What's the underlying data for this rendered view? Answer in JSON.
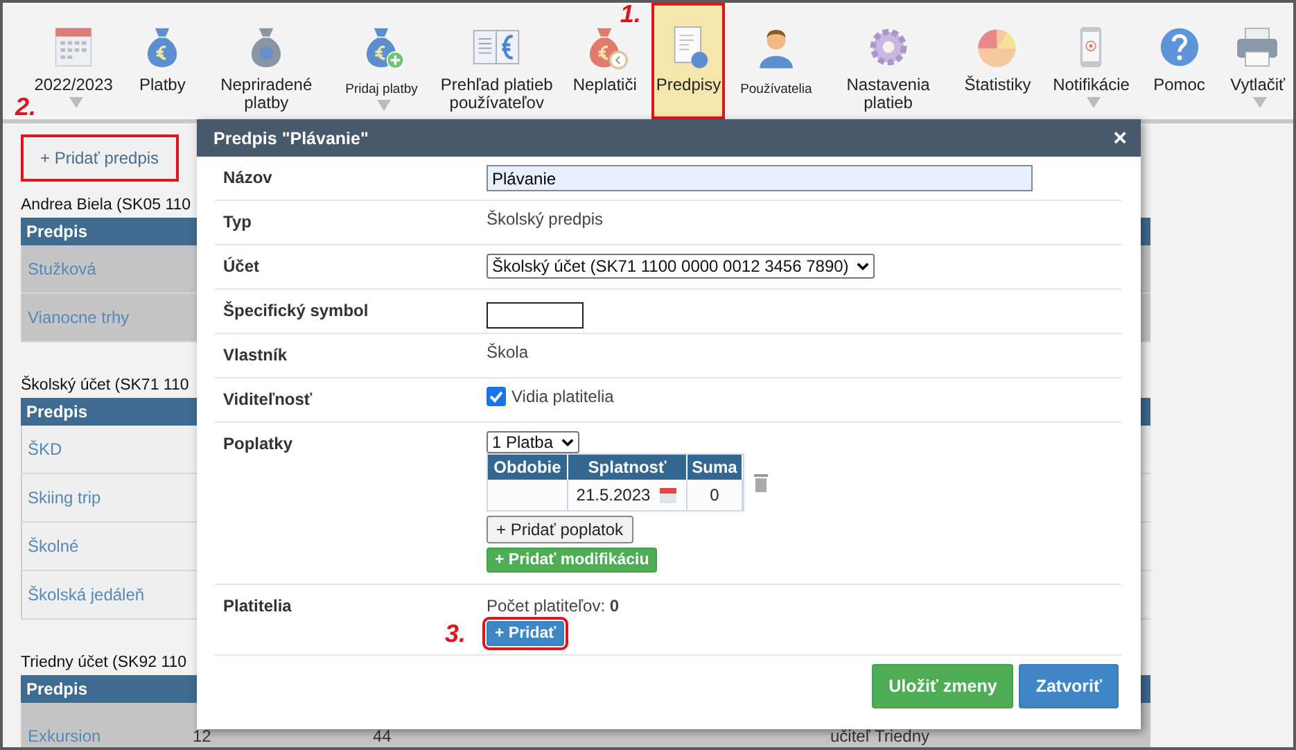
{
  "toolbar": [
    {
      "label": "2022/2023",
      "dropdown": true,
      "selected": false,
      "small": false
    },
    {
      "label": "Platby",
      "dropdown": false,
      "selected": false,
      "small": false
    },
    {
      "label": "Nepriradené platby",
      "dropdown": false,
      "selected": false,
      "small": false
    },
    {
      "label": "Pridaj platby",
      "dropdown": true,
      "selected": false,
      "small": true
    },
    {
      "label": "Prehľad platieb používateľov",
      "dropdown": false,
      "selected": false,
      "small": false
    },
    {
      "label": "Neplatiči",
      "dropdown": false,
      "selected": false,
      "small": false
    },
    {
      "label": "Predpisy",
      "dropdown": false,
      "selected": true,
      "small": false,
      "marker": "1."
    },
    {
      "label": "Používatelia",
      "dropdown": false,
      "selected": false,
      "small": true
    },
    {
      "label": "Nastavenia platieb",
      "dropdown": false,
      "selected": false,
      "small": false
    },
    {
      "label": "Štatistiky",
      "dropdown": false,
      "selected": false,
      "small": false
    },
    {
      "label": "Notifikácie",
      "dropdown": true,
      "selected": false,
      "small": false
    },
    {
      "label": "Pomoc",
      "dropdown": false,
      "selected": false,
      "small": false
    },
    {
      "label": "Vytlačiť",
      "dropdown": true,
      "selected": false,
      "small": false
    }
  ],
  "add_button": {
    "label": "+ Pridať predpis",
    "marker": "2."
  },
  "sections": [
    {
      "title": "Andrea Biela (SK05 110",
      "header": "Predpis",
      "rows": [
        {
          "name": "Stužková",
          "highlighted": true
        },
        {
          "name": "Vianocne trhy",
          "highlighted": true
        }
      ]
    },
    {
      "title": "Školský účet (SK71 110",
      "header": "Predpis",
      "rows": [
        {
          "name": "ŠKD",
          "highlighted": false
        },
        {
          "name": "Skiing trip",
          "highlighted": false
        },
        {
          "name": "Školné",
          "highlighted": false
        },
        {
          "name": "Školská jedáleň",
          "highlighted": false
        }
      ]
    },
    {
      "title": "Triedny účet (SK92 110",
      "header": "Predpis",
      "rows": [
        {
          "name": "Exkursion",
          "highlighted": true,
          "cells": [
            "12",
            "44",
            "učiteľ Triedny"
          ]
        }
      ]
    }
  ],
  "dialog": {
    "title": "Predpis \"Plávanie\"",
    "close": "×",
    "fields": [
      {
        "kind": "input",
        "label": "Názov",
        "value": "Plávanie"
      },
      {
        "kind": "text",
        "label": "Typ",
        "value": "Školský predpis"
      },
      {
        "kind": "select",
        "label": "Účet",
        "value": "Školský účet (SK71 1100 0000 0012 3456 7890)"
      },
      {
        "kind": "small-input",
        "label": "Špecifický symbol"
      },
      {
        "kind": "text",
        "label": "Vlastník",
        "value": "Škola"
      },
      {
        "kind": "checkbox",
        "label": "Viditeľnosť",
        "value": "Vidia platitelia",
        "checked": true
      },
      {
        "kind": "fees",
        "label": "Poplatky",
        "count": "1 Platba",
        "columns": [
          "Obdobie",
          "Splatnosť",
          "Suma"
        ],
        "due": "21.5.2023",
        "amount": "0",
        "add_fee": "+ Pridať poplatok",
        "add_modification": "+ Pridať modifikáciu"
      },
      {
        "kind": "payers",
        "label": "Platitelia",
        "value": "Počet platiteľov: **0**",
        "add": "+ Pridať",
        "marker": "3."
      }
    ],
    "buttons": [
      {
        "label": "Uložiť zmeny",
        "kind": "save"
      },
      {
        "label": "Zatvoriť",
        "kind": "close"
      }
    ]
  }
}
